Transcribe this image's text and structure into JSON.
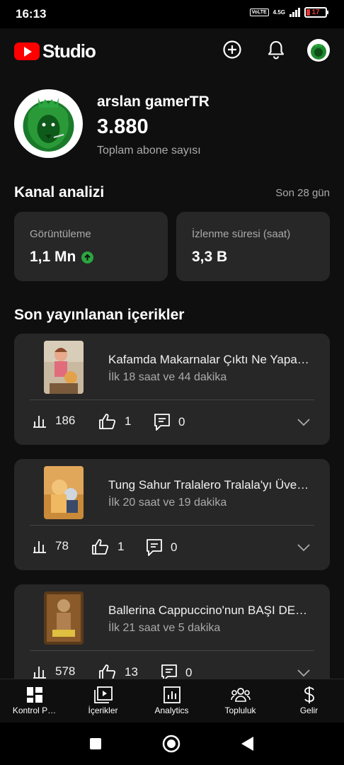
{
  "status_bar": {
    "time": "16:13",
    "network": "4.5G",
    "volte": "VoLTE",
    "battery": "17"
  },
  "header": {
    "logo_text": "Studio"
  },
  "channel": {
    "name": "arslan gamerTR",
    "subscribers": "3.880",
    "subscribers_label": "Toplam abone sayısı"
  },
  "analytics": {
    "title": "Kanal analizi",
    "period": "Son 28 gün",
    "cards": [
      {
        "label": "Görüntüleme",
        "value": "1,1 Mn",
        "trend": "up"
      },
      {
        "label": "İzlenme süresi (saat)",
        "value": "3,3 B"
      }
    ]
  },
  "recent": {
    "title": "Son yayınlanan içerikler",
    "items": [
      {
        "title": "Kafamda Makarnalar Çıktı Ne Yapa…",
        "subtitle": "İlk 18 saat ve 44 dakika",
        "views": "186",
        "likes": "1",
        "comments": "0"
      },
      {
        "title": "Tung Sahur Tralalero Tralala'yı Üvey …",
        "subtitle": "İlk 20 saat ve 19 dakika",
        "views": "78",
        "likes": "1",
        "comments": "0"
      },
      {
        "title": "Ballerina Cappuccino'nun BAŞI DER…",
        "subtitle": "İlk 21 saat ve 5 dakika",
        "views": "578",
        "likes": "13",
        "comments": "0"
      }
    ]
  },
  "bottom_nav": [
    "Kontrol P…",
    "İçerikler",
    "Analytics",
    "Topluluk",
    "Gelir"
  ],
  "colors": {
    "background": "#0f0f0f",
    "card": "#272727",
    "brand_red": "#ff0000",
    "trend_green": "#2ba640",
    "secondary_text": "#aaaaaa"
  }
}
